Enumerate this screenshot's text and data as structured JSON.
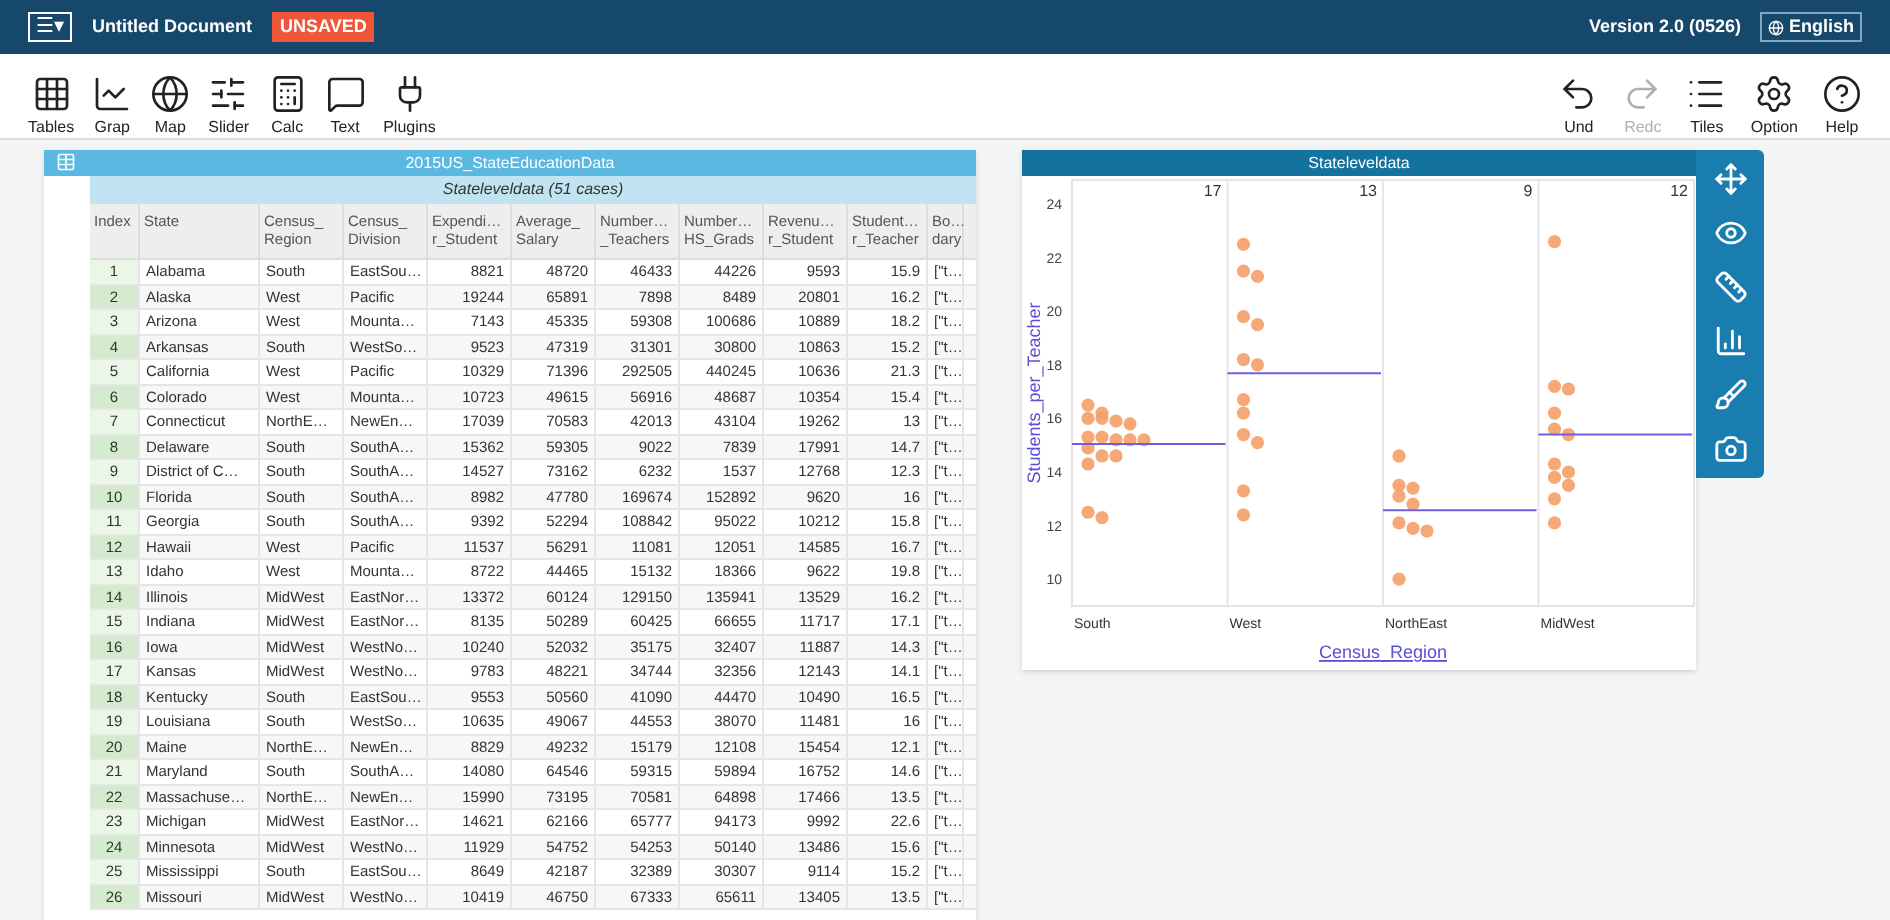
{
  "menu_bar": {
    "menu_button": "☰▾",
    "document_title": "Untitled Document",
    "status_badge": "UNSAVED",
    "version": "Version 2.0 (0526)",
    "language": "English"
  },
  "toolbar": {
    "left": [
      {
        "kind": "table",
        "label": "Tables"
      },
      {
        "kind": "graph",
        "label": "Grap"
      },
      {
        "kind": "map",
        "label": "Map"
      },
      {
        "kind": "slider",
        "label": "Slider"
      },
      {
        "kind": "calc",
        "label": "Calc"
      },
      {
        "kind": "text",
        "label": "Text"
      },
      {
        "kind": "plugins",
        "label": "Plugins"
      }
    ],
    "right": [
      {
        "kind": "undo",
        "label": "Und",
        "disabled": false
      },
      {
        "kind": "redo",
        "label": "Redc",
        "disabled": true
      },
      {
        "kind": "tiles",
        "label": "Tiles",
        "disabled": false
      },
      {
        "kind": "options",
        "label": "Option",
        "disabled": false
      },
      {
        "kind": "help",
        "label": "Help",
        "disabled": false
      }
    ]
  },
  "table": {
    "title": "2015US_StateEducationData",
    "collection": "Stateleveldata (51 cases)",
    "columns": [
      {
        "lines": [
          "Index"
        ]
      },
      {
        "lines": [
          "State"
        ]
      },
      {
        "lines": [
          "Census_",
          "Region"
        ]
      },
      {
        "lines": [
          "Census_",
          "Division"
        ]
      },
      {
        "lines": [
          "Expendi…",
          "r_Student"
        ]
      },
      {
        "lines": [
          "Average_",
          "Salary"
        ]
      },
      {
        "lines": [
          "Number…",
          "_Teachers"
        ]
      },
      {
        "lines": [
          "Number…",
          "HS_Grads"
        ]
      },
      {
        "lines": [
          "Revenu…",
          "r_Student"
        ]
      },
      {
        "lines": [
          "Student…",
          "r_Teacher"
        ]
      },
      {
        "lines": [
          "Bo…",
          "dary"
        ]
      }
    ],
    "rows": [
      [
        "1",
        "Alabama",
        "South",
        "EastSou…",
        "8821",
        "48720",
        "46433",
        "44226",
        "9593",
        "15.9",
        "[\"t…"
      ],
      [
        "2",
        "Alaska",
        "West",
        "Pacific",
        "19244",
        "65891",
        "7898",
        "8489",
        "20801",
        "16.2",
        "[\"t…"
      ],
      [
        "3",
        "Arizona",
        "West",
        "Mounta…",
        "7143",
        "45335",
        "59308",
        "100686",
        "10889",
        "18.2",
        "[\"t…"
      ],
      [
        "4",
        "Arkansas",
        "South",
        "WestSo…",
        "9523",
        "47319",
        "31301",
        "30800",
        "10863",
        "15.2",
        "[\"t…"
      ],
      [
        "5",
        "California",
        "West",
        "Pacific",
        "10329",
        "71396",
        "292505",
        "440245",
        "10636",
        "21.3",
        "[\"t…"
      ],
      [
        "6",
        "Colorado",
        "West",
        "Mounta…",
        "10723",
        "49615",
        "56916",
        "48687",
        "10354",
        "15.4",
        "[\"t…"
      ],
      [
        "7",
        "Connecticut",
        "NorthE…",
        "NewEn…",
        "17039",
        "70583",
        "42013",
        "43104",
        "19262",
        "13",
        "[\"t…"
      ],
      [
        "8",
        "Delaware",
        "South",
        "SouthA…",
        "15362",
        "59305",
        "9022",
        "7839",
        "17991",
        "14.7",
        "[\"t…"
      ],
      [
        "9",
        "District of C…",
        "South",
        "SouthA…",
        "14527",
        "73162",
        "6232",
        "1537",
        "12768",
        "12.3",
        "[\"t…"
      ],
      [
        "10",
        "Florida",
        "South",
        "SouthA…",
        "8982",
        "47780",
        "169674",
        "152892",
        "9620",
        "16",
        "[\"t…"
      ],
      [
        "11",
        "Georgia",
        "South",
        "SouthA…",
        "9392",
        "52294",
        "108842",
        "95022",
        "10212",
        "15.8",
        "[\"t…"
      ],
      [
        "12",
        "Hawaii",
        "West",
        "Pacific",
        "11537",
        "56291",
        "11081",
        "12051",
        "14585",
        "16.7",
        "[\"t…"
      ],
      [
        "13",
        "Idaho",
        "West",
        "Mounta…",
        "8722",
        "44465",
        "15132",
        "18366",
        "9622",
        "19.8",
        "[\"t…"
      ],
      [
        "14",
        "Illinois",
        "MidWest",
        "EastNor…",
        "13372",
        "60124",
        "129150",
        "135941",
        "13529",
        "16.2",
        "[\"t…"
      ],
      [
        "15",
        "Indiana",
        "MidWest",
        "EastNor…",
        "8135",
        "50289",
        "60425",
        "66655",
        "11717",
        "17.1",
        "[\"t…"
      ],
      [
        "16",
        "Iowa",
        "MidWest",
        "WestNo…",
        "10240",
        "52032",
        "35175",
        "32407",
        "11887",
        "14.3",
        "[\"t…"
      ],
      [
        "17",
        "Kansas",
        "MidWest",
        "WestNo…",
        "9783",
        "48221",
        "34744",
        "32356",
        "12143",
        "14.1",
        "[\"t…"
      ],
      [
        "18",
        "Kentucky",
        "South",
        "EastSou…",
        "9553",
        "50560",
        "41090",
        "44470",
        "10490",
        "16.5",
        "[\"t…"
      ],
      [
        "19",
        "Louisiana",
        "South",
        "WestSo…",
        "10635",
        "49067",
        "44553",
        "38070",
        "11481",
        "16",
        "[\"t…"
      ],
      [
        "20",
        "Maine",
        "NorthE…",
        "NewEn…",
        "8829",
        "49232",
        "15179",
        "12108",
        "15454",
        "12.1",
        "[\"t…"
      ],
      [
        "21",
        "Maryland",
        "South",
        "SouthA…",
        "14080",
        "64546",
        "59315",
        "59894",
        "16752",
        "14.6",
        "[\"t…"
      ],
      [
        "22",
        "Massachuse…",
        "NorthE…",
        "NewEn…",
        "15990",
        "73195",
        "70581",
        "64898",
        "17466",
        "13.5",
        "[\"t…"
      ],
      [
        "23",
        "Michigan",
        "MidWest",
        "EastNor…",
        "14621",
        "62166",
        "65777",
        "94173",
        "9992",
        "22.6",
        "[\"t…"
      ],
      [
        "24",
        "Minnesota",
        "MidWest",
        "WestNo…",
        "11929",
        "54752",
        "54253",
        "50140",
        "13486",
        "15.6",
        "[\"t…"
      ],
      [
        "25",
        "Mississippi",
        "South",
        "EastSou…",
        "8649",
        "42187",
        "32389",
        "30307",
        "9114",
        "15.2",
        "[\"t…"
      ],
      [
        "26",
        "Missouri",
        "MidWest",
        "WestNo…",
        "10419",
        "46750",
        "67333",
        "65611",
        "13405",
        "13.5",
        "[\"t…"
      ]
    ]
  },
  "graph": {
    "title": "Stateleveldata",
    "counts": [
      "17",
      "13",
      "9",
      "12"
    ],
    "means_shown": true,
    "palette": [
      {
        "kind": "scale"
      },
      {
        "kind": "hide"
      },
      {
        "kind": "ruler"
      },
      {
        "kind": "chart"
      },
      {
        "kind": "brush"
      },
      {
        "kind": "camera"
      }
    ],
    "x_axis_label": "Census_Region",
    "y_axis_label": "Students_per_Teacher",
    "y_ticks": [
      "24",
      "22",
      "20",
      "18",
      "16",
      "14",
      "12",
      "10"
    ],
    "categories": [
      "South",
      "West",
      "NorthEast",
      "MidWest"
    ]
  }
}
